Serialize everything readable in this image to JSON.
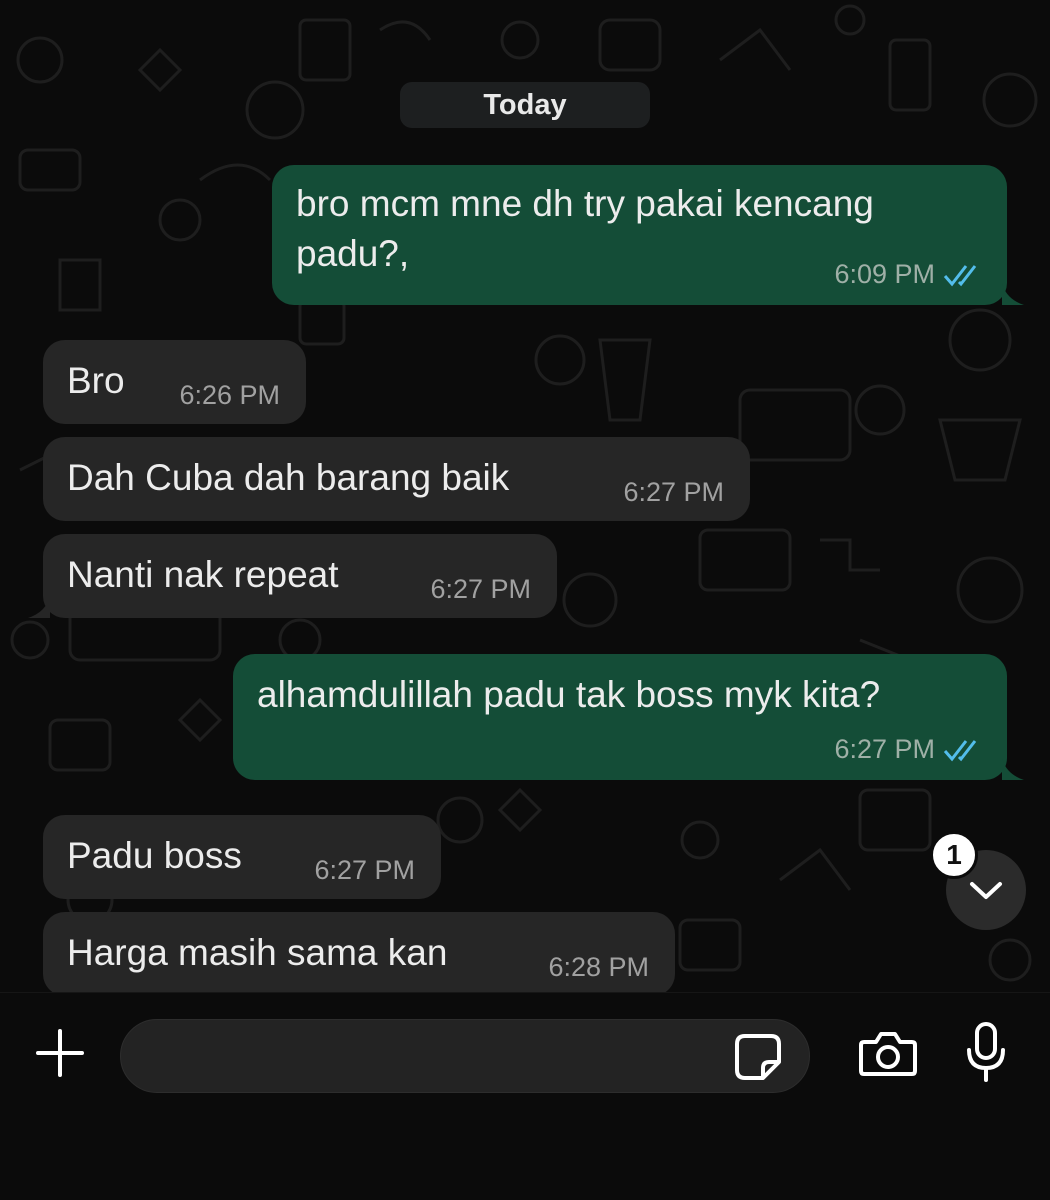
{
  "chat": {
    "date_label": "Today",
    "messages": [
      {
        "direction": "out",
        "lines": [
          "bro mcm mne dh try pakai kencang",
          "padu?,"
        ],
        "time": "6:09 PM",
        "status": "read"
      },
      {
        "direction": "in",
        "lines": [
          "Bro"
        ],
        "time": "6:26 PM"
      },
      {
        "direction": "in",
        "lines": [
          "Dah Cuba dah barang baik"
        ],
        "time": "6:27 PM"
      },
      {
        "direction": "in",
        "lines": [
          "Nanti nak repeat"
        ],
        "time": "6:27 PM"
      },
      {
        "direction": "out",
        "lines": [
          "alhamdulillah padu tak boss myk kita?"
        ],
        "time": "6:27 PM",
        "status": "read"
      },
      {
        "direction": "in",
        "lines": [
          "Padu boss"
        ],
        "time": "6:27 PM"
      },
      {
        "direction": "in",
        "lines": [
          "Harga masih sama kan"
        ],
        "time": "6:28 PM"
      }
    ],
    "unread_count": "1"
  },
  "composer": {
    "input_value": "",
    "icons": {
      "attach": "plus-icon",
      "sticker": "sticker-icon",
      "camera": "camera-icon",
      "mic": "microphone-icon",
      "scroll": "chevron-down-icon",
      "read_receipt": "double-check-icon"
    }
  },
  "colors": {
    "background": "#0b0b0b",
    "outgoing_bubble": "#144d37",
    "incoming_bubble": "#262626",
    "read_tick": "#53bdeb",
    "text": "#ececec"
  }
}
